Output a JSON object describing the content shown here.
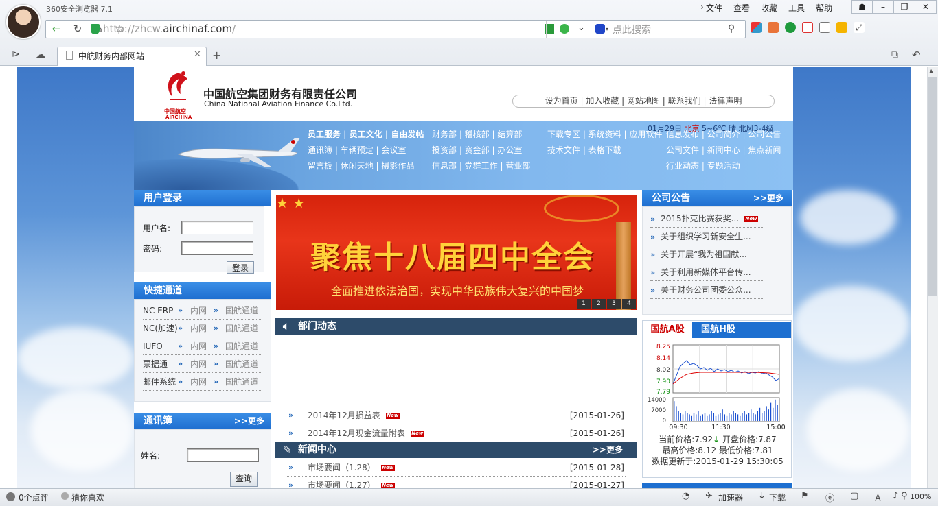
{
  "browser": {
    "app_title": "360安全浏览器 7.1",
    "menu": [
      "文件",
      "查看",
      "收藏",
      "工具",
      "帮助"
    ],
    "url_prefix": "http://zhcw.",
    "url_domain": "airchinaf.com",
    "url_suffix": "/",
    "search_placeholder": "点此搜索",
    "tab_title": "中航财务内部网站",
    "status_comments": "0个点评",
    "status_guess": "猜你喜欢",
    "status_accelerator": "加速器",
    "status_download": "下载",
    "status_zoom": "100%"
  },
  "header": {
    "company_cn": "中国航空集团财务有限责任公司",
    "company_en": "China National Aviation Finance Co.Ltd.",
    "logo_text_cn": "中国航空",
    "logo_text_en": "AIRCHINA",
    "top_links": "设为首页 | 加入收藏 | 网站地图 | 联系我们 | 法律声明"
  },
  "nav": {
    "col1": [
      "员工服务 | 员工文化 | 自由发帖",
      "通讯簿 | 车辆预定 | 会议室",
      "留言板 | 休闲天地 | 摄影作品"
    ],
    "col2": [
      "财务部 | 稽核部 | 结算部",
      "投资部 | 资金部 | 办公室",
      "信息部 | 党群工作 | 营业部"
    ],
    "col3": [
      "下载专区 | 系统资料 | 应用软件",
      "技术文件 | 表格下载"
    ],
    "col4": [
      "信息发布 | 公司简介 | 公司公告",
      "公司文件 | 新闻中心 | 焦点新闻",
      "行业动态 | 专题活动"
    ],
    "weather_date": "01月29日",
    "weather_city": "北京",
    "weather_desc": "5~6℃ 晴 北风3-4级"
  },
  "login": {
    "title": "用户登录",
    "username_label": "用户名:",
    "password_label": "密码:",
    "submit": "登录"
  },
  "quick": {
    "title": "快捷通道",
    "rows": [
      {
        "name": "NC ERP",
        "a": "内网",
        "b": "国航通道"
      },
      {
        "name": "NC(加速)",
        "a": "内网",
        "b": "国航通道"
      },
      {
        "name": "IUFO",
        "a": "内网",
        "b": "国航通道"
      },
      {
        "name": "票据通",
        "a": "内网",
        "b": "国航通道"
      },
      {
        "name": "邮件系统",
        "a": "内网",
        "b": "国航通道"
      }
    ]
  },
  "contacts": {
    "title": "通讯簿",
    "more": ">>更多",
    "name_label": "姓名:",
    "submit": "查询"
  },
  "slider": {
    "title": "聚焦十八届四中全会",
    "subtitle": "全面推进依法治国，实现中华民族伟大复兴的中国梦",
    "pages": [
      "1",
      "2",
      "3",
      "4"
    ]
  },
  "dept": {
    "title": "部门动态",
    "items": [
      {
        "text": "2014年12月损益表",
        "date": "[2015-01-26]",
        "new": "New"
      },
      {
        "text": "2014年12月现金流量附表",
        "date": "[2015-01-26]",
        "new": "New"
      }
    ]
  },
  "news": {
    "title": "新闻中心",
    "more": ">>更多",
    "items": [
      {
        "text": "市场要闻（1.28）",
        "date": "[2015-01-28]",
        "new": "New"
      },
      {
        "text": "市场要闻（1.27）",
        "date": "[2015-01-27]",
        "new": "New"
      }
    ]
  },
  "notice": {
    "title": "公司公告",
    "more": ">>更多",
    "items": [
      "2015扑克比赛获奖...",
      "关于组织学习新安全生...",
      "关于开展“我为祖国献...",
      "关于利用新媒体平台传...",
      "关于财务公司团委公众..."
    ],
    "new": "New"
  },
  "stock": {
    "tab_a": "国航A股",
    "tab_h": "国航H股",
    "price_ticks": [
      "8.25",
      "8.14",
      "8.02",
      "7.90",
      "7.79"
    ],
    "volume_ticks": [
      "14000",
      "7000",
      "0"
    ],
    "time_ticks": [
      "09:30",
      "11:30",
      "15:00"
    ],
    "current_label": "当前价格:",
    "current": "7.92",
    "open_label": "开盘价格:",
    "open": "7.87",
    "high_label": "最高价格:",
    "high": "8.12",
    "low_label": "最低价格:",
    "low": "7.81",
    "updated_label": "数据更新于:",
    "updated": "2015-01-29 15:30:05"
  },
  "colors": {
    "accent": "#1f6fd0",
    "dark_bar": "#2d4b6a",
    "red": "#cc0000"
  }
}
